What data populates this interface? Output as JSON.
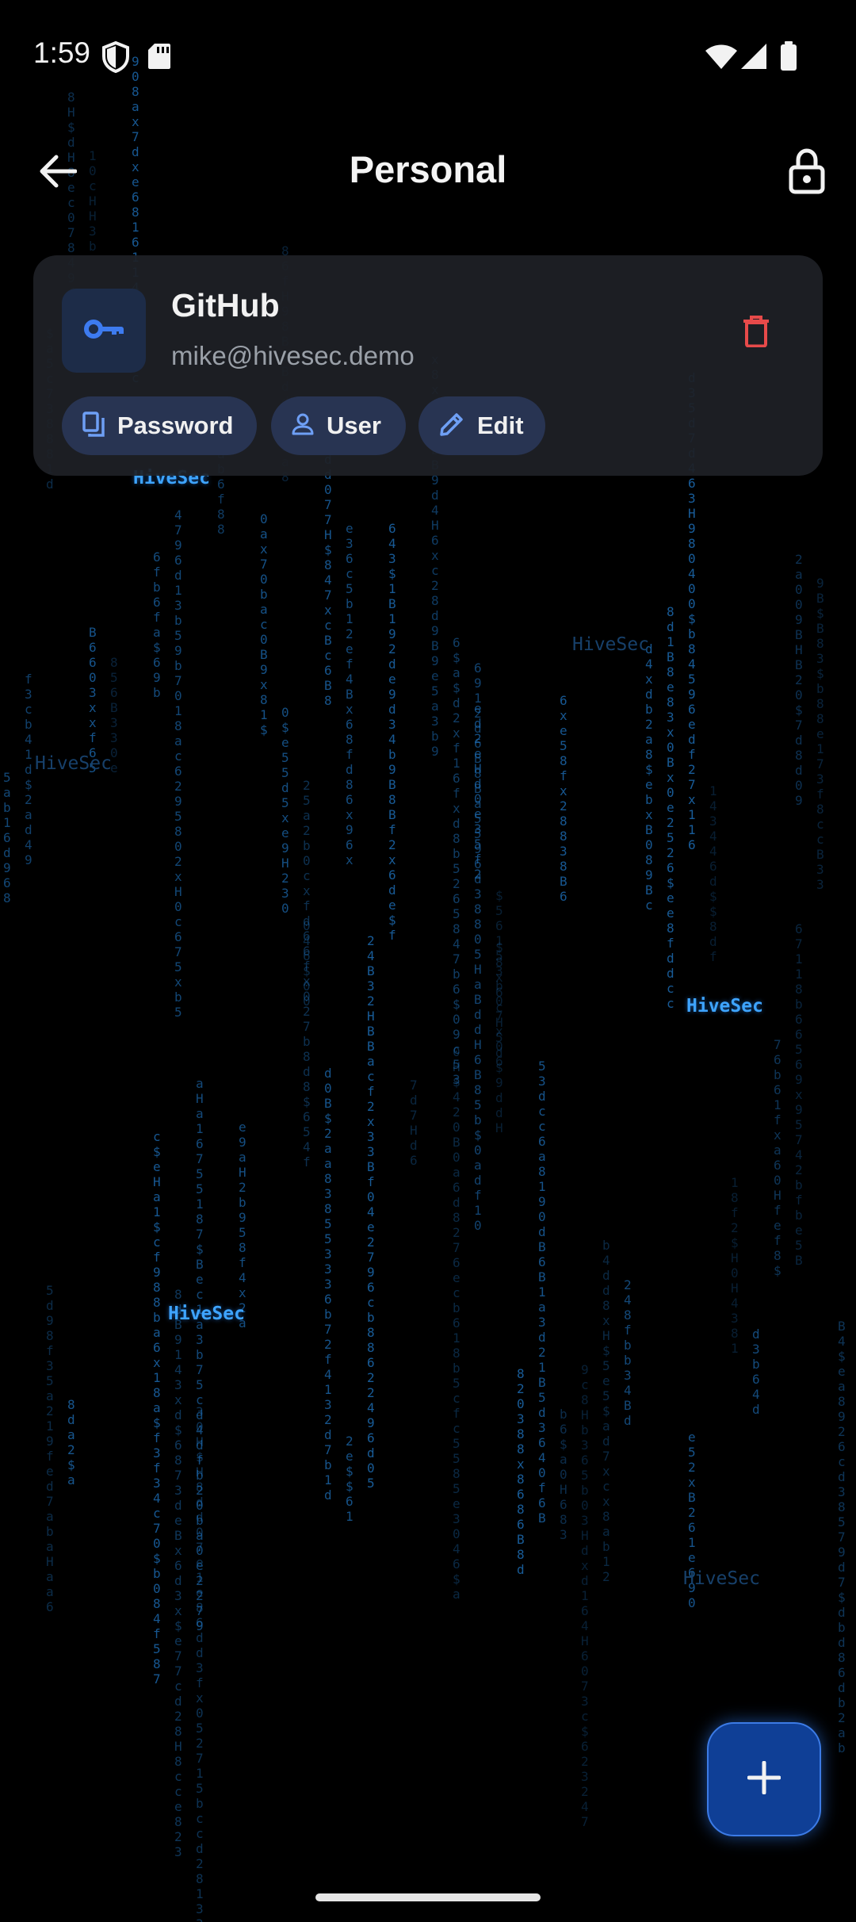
{
  "status_bar": {
    "time": "1:59",
    "icons": [
      "shield-icon",
      "sd-card-icon",
      "wifi-icon",
      "signal-icon",
      "battery-icon"
    ]
  },
  "app_bar": {
    "title": "Personal",
    "back_icon": "arrow-back-icon",
    "lock_icon": "lock-icon"
  },
  "entry": {
    "title": "GitHub",
    "username": "mike@hivesec.demo",
    "icon": "key-icon",
    "delete_icon": "trash-icon",
    "actions": [
      {
        "label": "Password",
        "icon": "copy-icon"
      },
      {
        "label": "User",
        "icon": "person-icon"
      },
      {
        "label": "Edit",
        "icon": "pencil-icon"
      }
    ]
  },
  "background": {
    "watermark": "HiveSec",
    "colors": {
      "rain": "#1e6fb8",
      "highlight": "#3ea4ff"
    }
  },
  "fab": {
    "icon": "plus-icon"
  },
  "colors": {
    "accent": "#3d7bf0",
    "danger": "#e74a4a",
    "card": "#1e2026",
    "chip": "#283452"
  }
}
